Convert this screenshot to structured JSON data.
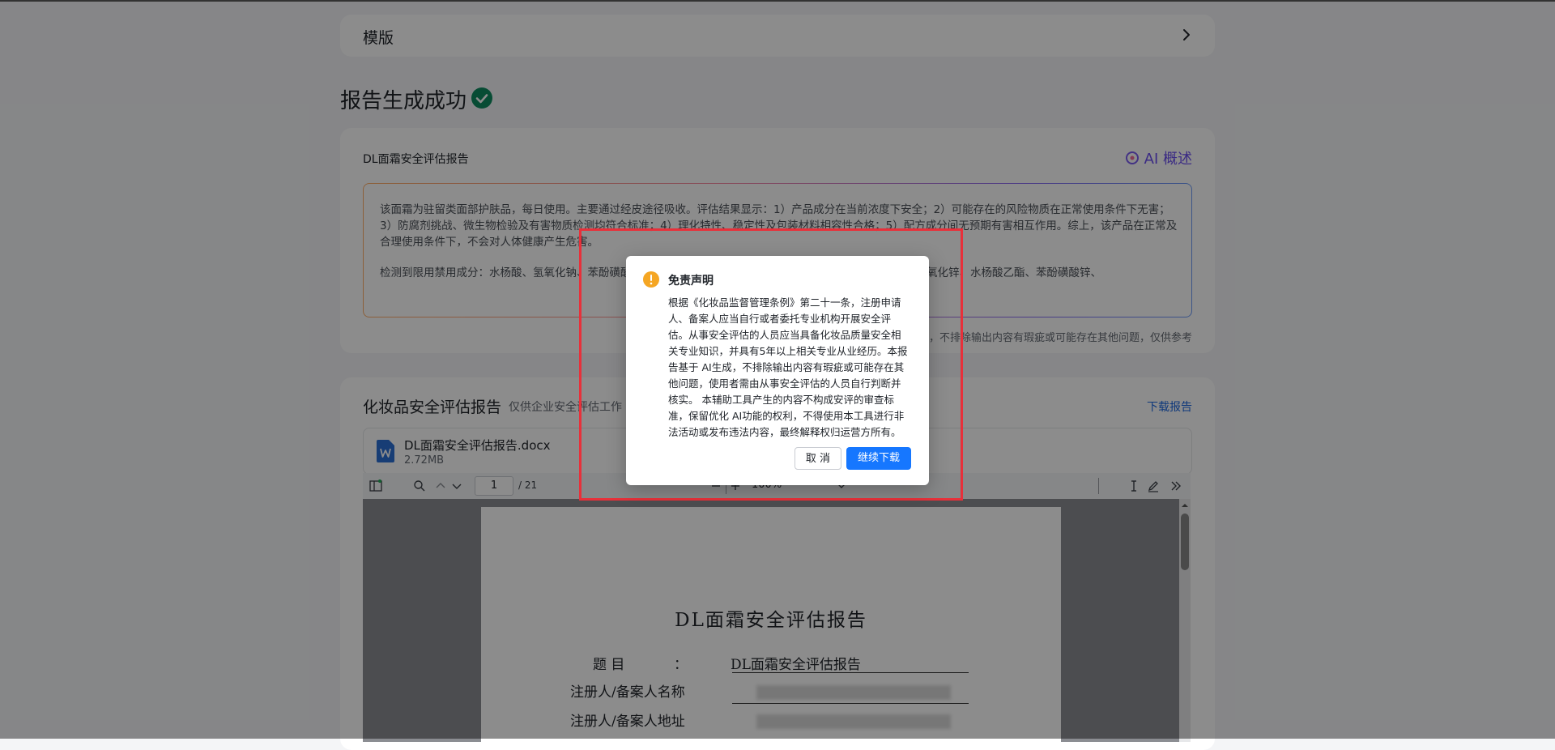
{
  "template_section": {
    "title": "模版"
  },
  "success": {
    "title": "报告生成成功"
  },
  "ai_summary": {
    "card_title": "DL面霜安全评估报告",
    "tab_label": "AI 概述",
    "paragraph1": "该面霜为驻留类面部护肤品，每日使用。主要通过经皮途径吸收。评估结果显示：1）产品成分在当前浓度下安全；2）可能存在的风险物质在正常使用条件下无害；3）防腐剂挑战、微生物检验及有害物质检测均符合标准；4）理化特性、稳定性及包装材料相容性合格；5）配方成分间无预期有害相互作用。综上，该产品在正常及合理使用条件下，不会对人体健康产生危害。",
    "paragraph2": "检测到限用禁用成分：水杨酸、氢氧化钠、苯酚磺酸锌、吡硫鎓锌、苯扎氯铵、苯甲酸钠、氯化羟锆铝配合物、过氧化锌、水杨酸乙酯、苯酚磺酸锌、",
    "disclaimer_note": "成，不排除输出内容有瑕疵或可能存在其他问题，仅供参考"
  },
  "report": {
    "title": "化妆品安全评估报告",
    "subtitle": "仅供企业安全评估工作",
    "download_label": "下载报告",
    "file": {
      "name": "DL面霜安全评估报告.docx",
      "size": "2.72MB"
    },
    "viewer": {
      "page_current": "1",
      "page_total": "/ 21",
      "zoom": "100%"
    },
    "document": {
      "title": "DL面霜安全评估报告",
      "row1_label": "题    目",
      "row1_colon": "：",
      "row1_value": "DL面霜安全评估报告",
      "row2_label": "注册人/备案人名称",
      "row3_label": "注册人/备案人地址"
    }
  },
  "dialog": {
    "title": "免责声明",
    "body": "根据《化妆品监督管理条例》第二十一条，注册申请人、备案人应当自行或者委托专业机构开展安全评估。从事安全评估的人员应当具备化妆品质量安全相关专业知识，并具有5年以上相关专业从业经历。本报告基于 AI生成，不排除输出内容有瑕疵或可能存在其他问题，使用者需由从事安全评估的人员自行判断并核实。 本辅助工具产生的内容不构成安评的审查标准，保留优化 AI功能的权利，不得使用本工具进行非法活动或发布违法内容，最终解释权归运营方所有。",
    "cancel_label": "取 消",
    "confirm_label": "继续下载"
  },
  "colors": {
    "accent": "#1677ff",
    "success": "#0e8a5f",
    "warning": "#f5a623",
    "highlight": "#e8303a"
  }
}
